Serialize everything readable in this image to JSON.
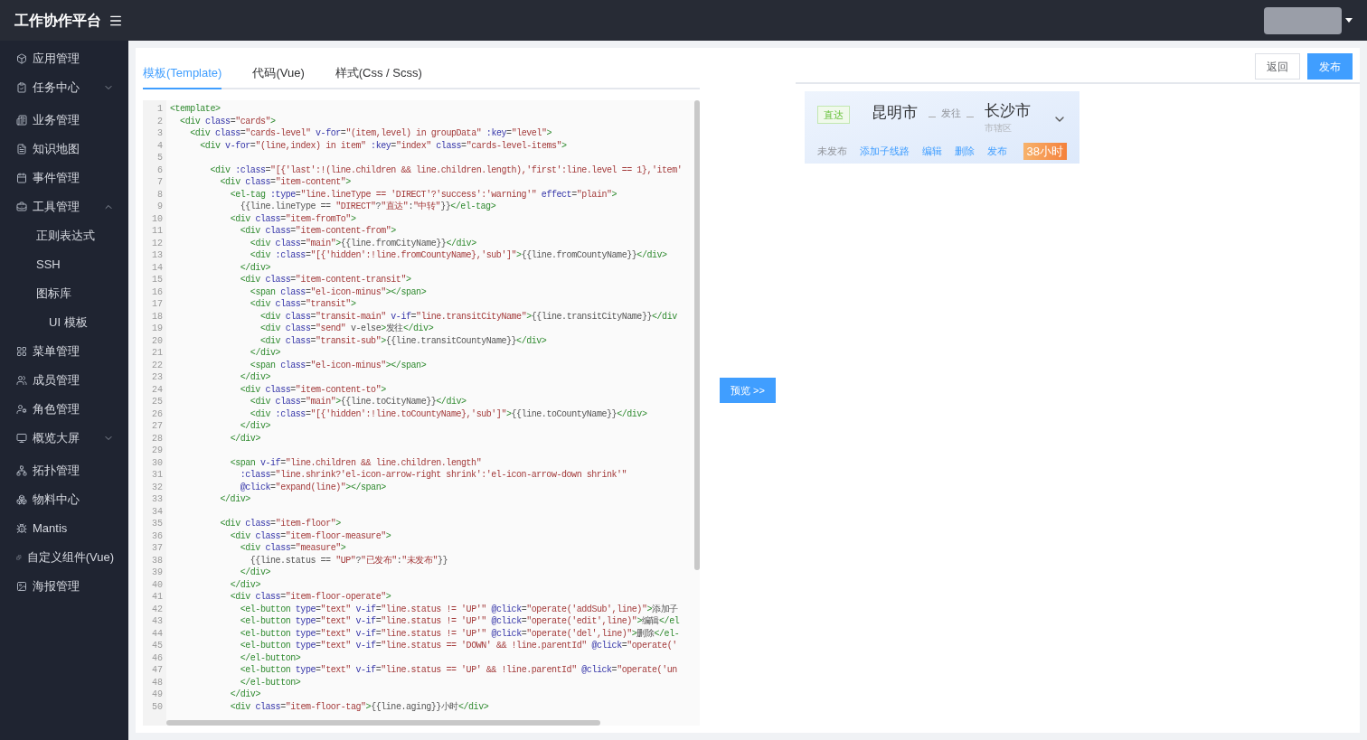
{
  "header": {
    "title": "工作协作平台"
  },
  "sidebar": {
    "items": [
      {
        "label": "应用管理"
      },
      {
        "label": "任务中心",
        "expanded": false
      },
      {
        "label": "业务管理"
      },
      {
        "label": "知识地图"
      },
      {
        "label": "事件管理"
      },
      {
        "label": "工具管理",
        "expanded": true,
        "children": [
          {
            "label": "正则表达式"
          },
          {
            "label": "SSH"
          },
          {
            "label": "图标库",
            "children": [
              {
                "label": "UI 模板"
              }
            ]
          }
        ]
      },
      {
        "label": "菜单管理"
      },
      {
        "label": "成员管理"
      },
      {
        "label": "角色管理"
      },
      {
        "label": "概览大屏",
        "expanded": false
      },
      {
        "label": "拓扑管理"
      },
      {
        "label": "物料中心"
      },
      {
        "label": "Mantis"
      },
      {
        "label": "自定义组件(Vue)"
      },
      {
        "label": "海报管理"
      }
    ]
  },
  "editor": {
    "tabs": [
      {
        "label": "模板(Template)",
        "selected": true
      },
      {
        "label": "代码(Vue)",
        "selected": false
      },
      {
        "label": "样式(Css / Scss)",
        "selected": false
      }
    ],
    "lines": [
      {
        "number": "1",
        "code": "<template>"
      },
      {
        "number": "2",
        "code": "  <div class=\"cards\">"
      },
      {
        "number": "3",
        "code": "    <div class=\"cards-level\" v-for=\"(item,level) in groupData\" :key=\"level\">"
      },
      {
        "number": "4",
        "code": "      <div v-for=\"(line,index) in item\" :key=\"index\" class=\"cards-level-items\">"
      },
      {
        "number": "5"
      },
      {
        "number": "6",
        "code": "        <div :class=\"[{'last':!(line.children && line.children.length),'first':line.level == 1},'item'"
      },
      {
        "number": "7",
        "code": "          <div class=\"item-content\">"
      },
      {
        "number": "8",
        "code": "            <el-tag :type=\"line.lineType == 'DIRECT'?'success':'warning'\" effect=\"plain\">"
      },
      {
        "number": "9",
        "code": "              {{line.lineType == \"DIRECT\"?\"直达\":\"中转\"}}</el-tag>"
      },
      {
        "number": "10",
        "code": "            <div class=\"item-fromTo\">"
      },
      {
        "number": "11",
        "code": "              <div class=\"item-content-from\">"
      },
      {
        "number": "12",
        "code": "                <div class=\"main\">{{line.fromCityName}}</div>"
      },
      {
        "number": "13",
        "code": "                <div :class=\"[{'hidden':!line.fromCountyName},'sub']\">{{line.fromCountyName}}</div>"
      },
      {
        "number": "14",
        "code": "              </div>"
      },
      {
        "number": "15",
        "code": "              <div class=\"item-content-transit\">"
      },
      {
        "number": "16",
        "code": "                <span class=\"el-icon-minus\"></span>"
      },
      {
        "number": "17",
        "code": "                <div class=\"transit\">"
      },
      {
        "number": "18",
        "code": "                  <div class=\"transit-main\" v-if=\"line.transitCityName\">{{line.transitCityName}}</div"
      },
      {
        "number": "19",
        "code": "                  <div class=\"send\" v-else>发往</div>"
      },
      {
        "number": "20",
        "code": "                  <div class=\"transit-sub\">{{line.transitCountyName}}</div>"
      },
      {
        "number": "21",
        "code": "                </div>"
      },
      {
        "number": "22",
        "code": "                <span class=\"el-icon-minus\"></span>"
      },
      {
        "number": "23",
        "code": "              </div>"
      },
      {
        "number": "24",
        "code": "              <div class=\"item-content-to\">"
      },
      {
        "number": "25",
        "code": "                <div class=\"main\">{{line.toCityName}}</div>"
      },
      {
        "number": "26",
        "code": "                <div :class=\"[{'hidden':!line.toCountyName},'sub']\">{{line.toCountyName}}</div>"
      },
      {
        "number": "27",
        "code": "              </div>"
      },
      {
        "number": "28",
        "code": "            </div>"
      },
      {
        "number": "29"
      },
      {
        "number": "30",
        "code": "            <span v-if=\"line.children && line.children.length\""
      },
      {
        "number": "31",
        "code": "              :class=\"line.shrink?'el-icon-arrow-right shrink':'el-icon-arrow-down shrink'\""
      },
      {
        "number": "32",
        "code": "              @click=\"expand(line)\"></span>"
      },
      {
        "number": "33",
        "code": "          </div>"
      },
      {
        "number": "34"
      },
      {
        "number": "35",
        "code": "          <div class=\"item-floor\">"
      },
      {
        "number": "36",
        "code": "            <div class=\"item-floor-measure\">"
      },
      {
        "number": "37",
        "code": "              <div class=\"measure\">"
      },
      {
        "number": "38",
        "code": "                {{line.status == \"UP\"?\"已发布\":\"未发布\"}}"
      },
      {
        "number": "39",
        "code": "              </div>"
      },
      {
        "number": "40",
        "code": "            </div>"
      },
      {
        "number": "41",
        "code": "            <div class=\"item-floor-operate\">"
      },
      {
        "number": "42",
        "code": "              <el-button type=\"text\" v-if=\"line.status != 'UP'\" @click=\"operate('addSub',line)\">添加子"
      },
      {
        "number": "43",
        "code": "              <el-button type=\"text\" v-if=\"line.status != 'UP'\" @click=\"operate('edit',line)\">编辑</el"
      },
      {
        "number": "44",
        "code": "              <el-button type=\"text\" v-if=\"line.status != 'UP'\" @click=\"operate('del',line)\">删除</el-"
      },
      {
        "number": "45",
        "code": "              <el-button type=\"text\" v-if=\"line.status == 'DOWN' && !line.parentId\" @click=\"operate('"
      },
      {
        "number": "46",
        "code": "              </el-button>"
      },
      {
        "number": "47",
        "code": "              <el-button type=\"text\" v-if=\"line.status == 'UP' && !line.parentId\" @click=\"operate('un"
      },
      {
        "number": "48",
        "code": "              </el-button>"
      },
      {
        "number": "49",
        "code": "            </div>"
      },
      {
        "number": "50",
        "code": "            <div class=\"item-floor-tag\">{{line.aging}}小时</div>"
      }
    ]
  },
  "preview_button": "预览 >>",
  "actions": [
    "返回",
    "发布"
  ],
  "card": {
    "tag": "直达",
    "from": "昆明市",
    "transit": "发往",
    "to": "长沙市",
    "to_sub": "市辖区",
    "status": "未发布",
    "operations": [
      "添加子线路",
      "编辑",
      "删除",
      "发布"
    ],
    "aging": "38小时"
  }
}
